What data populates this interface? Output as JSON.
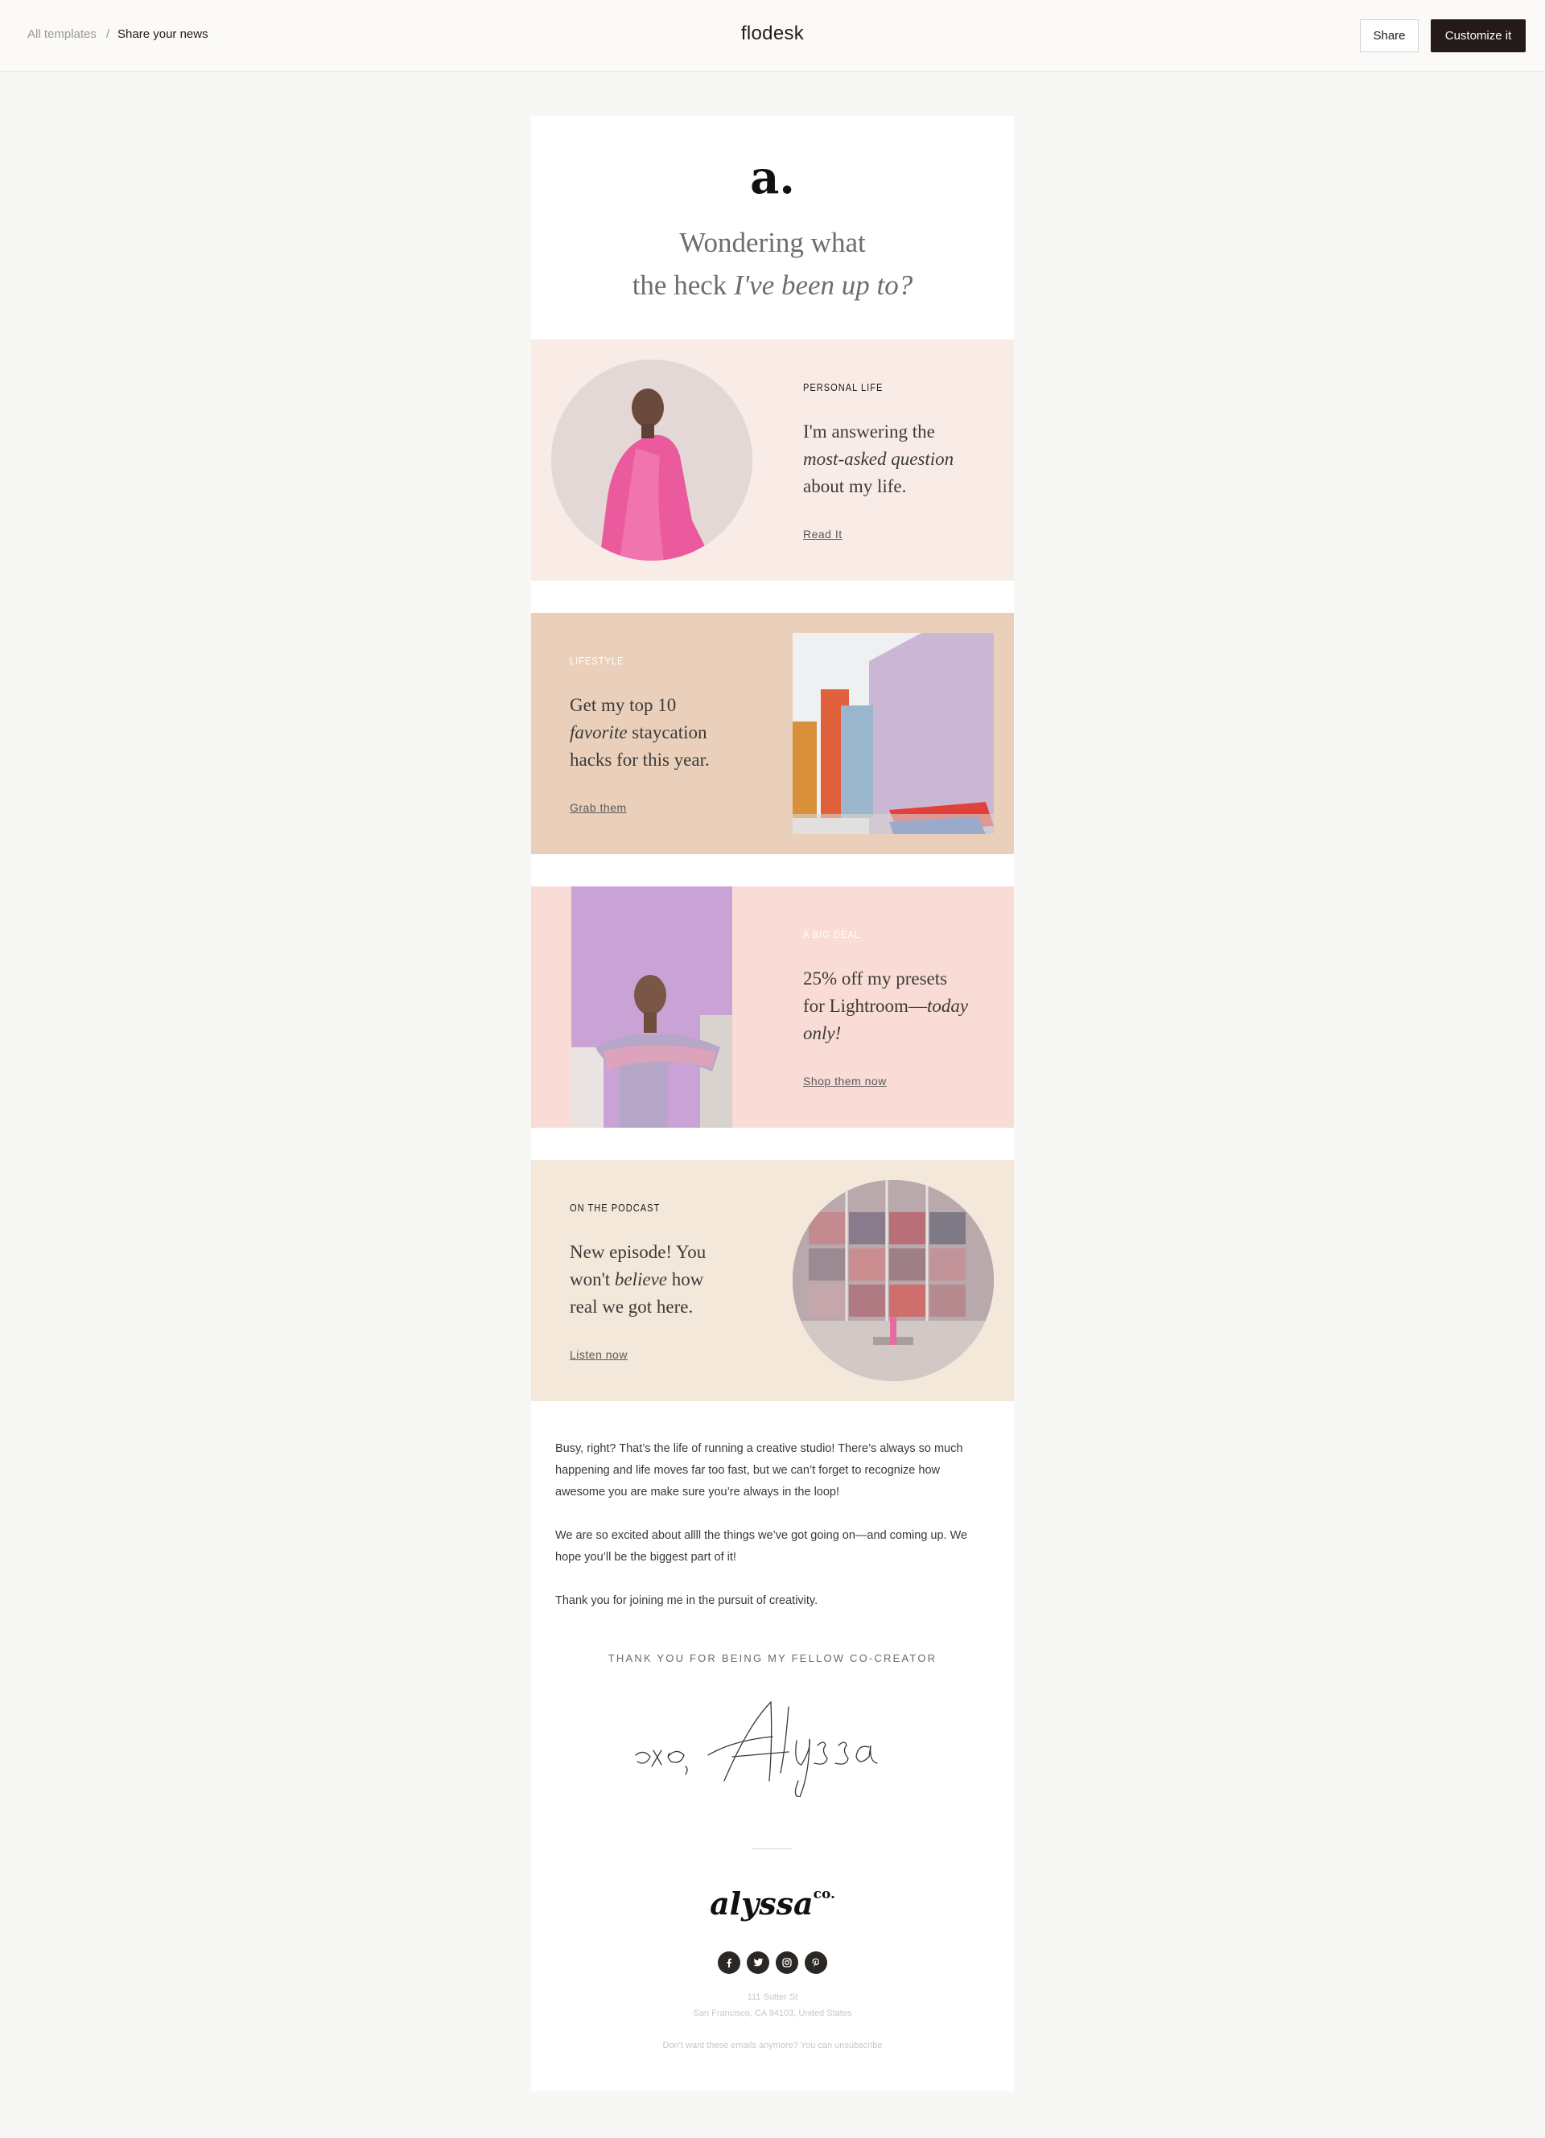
{
  "topbar": {
    "breadcrumb_root": "All templates",
    "breadcrumb_sep": "/",
    "breadcrumb_current": "Share your news",
    "brand": "flodesk",
    "share_label": "Share",
    "customize_label": "Customize it"
  },
  "email": {
    "logo_mark": "a.",
    "headline_line1": "Wondering what",
    "headline_line2_plain": "the heck ",
    "headline_line2_italic": "I've been up to?",
    "blocks": [
      {
        "label": "Personal Life",
        "text_a": "I'm answering the",
        "text_b_italic": "most-asked question",
        "text_c": "about my life.",
        "cta": "Read It"
      },
      {
        "label": "Lifestyle",
        "text_a": "Get my top 10",
        "text_b_italic": "favorite",
        "text_b_rest": " staycation",
        "text_c": "hacks for this year.",
        "cta": "Grab them"
      },
      {
        "label": "A Big Deal",
        "text_a": "25% off my presets",
        "text_b": "for Lightroom—",
        "text_b_italic": "today",
        "text_c_italic": "only!",
        "cta": "Shop them now"
      },
      {
        "label": "On the Podcast",
        "text_a": "New episode! You",
        "text_b": "won't ",
        "text_b_italic": "believe",
        "text_b_rest": " how",
        "text_c": "real we got here.",
        "cta": "Listen now"
      }
    ],
    "para1": "Busy, right? That’s the life of running a creative studio! There’s always so much happening and life moves far too fast, but we can’t forget to recognize how awesome you are make sure you’re always in the loop!",
    "para2": "We are so excited about allll the things we’ve got going on—and coming up. We hope you’ll be the biggest part of it!",
    "para3": "Thank you for joining me in the pursuit of creativity.",
    "thanks": "THANK YOU FOR BEING MY FELLOW CO-CREATOR",
    "signature": "xo, Alyssa",
    "footer_logo": "alyssa",
    "footer_logo_sup": "co.",
    "address_line1": "111 Sutter St",
    "address_line2": "San Francisco, CA 94103, United States",
    "unsubscribe": "Don't want these emails anymore? You can unsubscribe",
    "socials": [
      "facebook-icon",
      "twitter-icon",
      "instagram-icon",
      "pinterest-icon"
    ]
  },
  "colors": {
    "block_personal": "#f9ece7",
    "block_lifestyle": "#ead0bb",
    "block_deal": "#f9dcd5",
    "block_podcast": "#f3e8da",
    "primary_button": "#241a17"
  }
}
